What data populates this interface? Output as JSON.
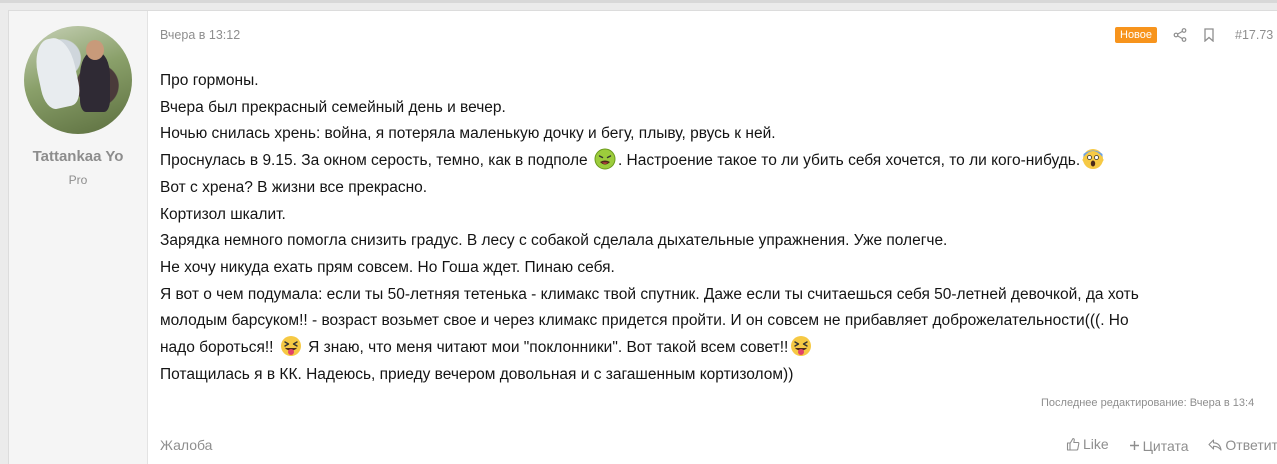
{
  "user": {
    "name": "Tattankaa Yo",
    "title": "Pro"
  },
  "post": {
    "date": "Вчера в 13:12",
    "badge": "Новое",
    "number": "#17.73",
    "lines": [
      {
        "text": "Про гормоны."
      },
      {
        "text": "Вчера был прекрасный семейный день и вечер."
      },
      {
        "text": "Ночью снилась хрень: война, я потеряла маленькую дочку и бегу, плыву, рвусь к ней."
      },
      {
        "pre": "Проснулась в 9.15. За окном серость, темно, как в подполе ",
        "emoji1": "nauseated-face-emoji",
        "mid": ". Настроение такое то ли убить себя хочется, то ли кого-нибудь.",
        "emoji2": "screaming-face-emoji"
      },
      {
        "text": "Вот с хрена? В жизни все прекрасно."
      },
      {
        "text": "Кортизол шкалит."
      },
      {
        "text": "Зарядка немного помогла снизить градус. В лесу с собакой сделала дыхательные упражнения. Уже полегче."
      },
      {
        "text": "Не хочу никуда ехать прям совсем. Но Гоша ждет. Пинаю себя."
      },
      {
        "text": "Я вот о чем подумала: если ты 50-летняя тетенька - климакс твой спутник. Даже если ты считаешься себя 50-летней девочкой, да хоть"
      },
      {
        "text": "молодым барсуком!! - возраст возьмет свое и через климакс придется пройти. И он совсем не прибавляет доброжелательности(((. Но"
      },
      {
        "pre": "надо бороться!! ",
        "emoji1": "tongue-face-emoji",
        "mid": " Я знаю, что меня читают мои \"поклонники\". Вот такой всем совет!!",
        "emoji2": "tongue-face-emoji"
      },
      {
        "text": "Потащилась я в КК. Надеюсь, приеду вечером довольная и с загашенным кортизолом))"
      }
    ],
    "edited": "Последнее редактирование: Вчера в 13:4"
  },
  "footer": {
    "report": "Жалоба",
    "like": "Like",
    "quote": "Цитата",
    "reply": "Ответит"
  },
  "colors": {
    "badge": "#f7941d",
    "muted": "#8e8e8e",
    "page_bg": "#ebebeb",
    "sidebar_bg": "#f5f5f5"
  }
}
